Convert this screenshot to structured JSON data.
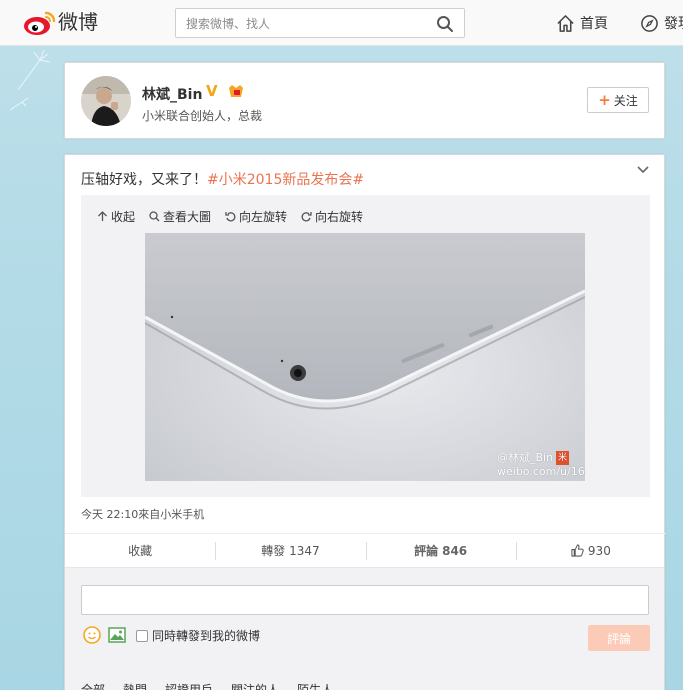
{
  "header": {
    "logo_text": "微博",
    "search_placeholder": "搜索微博、找人",
    "nav_home": "首頁",
    "nav_discover": "發現"
  },
  "profile": {
    "name": "林斌_Bin",
    "verified_mark": "V",
    "description": "小米联合创始人，总裁",
    "follow_label": "关注"
  },
  "post": {
    "text": "压轴好戏，又来了！",
    "topic": "#小米2015新品发布会#",
    "media_tools": [
      "收起",
      "查看大圖",
      "向左旋转",
      "向右旋转"
    ],
    "watermark_line1": "@林斌_Bin",
    "watermark_line2": "weibo.com/u/1686364349",
    "meta": "今天 22:10來自小米手机",
    "actions": {
      "favorite_label": "收藏",
      "repost_label": "轉發",
      "repost_count": "1347",
      "comment_label": "評論",
      "comment_count": "846",
      "like_count": "930"
    }
  },
  "comment_box": {
    "repost_checkbox_label": "同時轉發到我的微博",
    "submit_label": "評論",
    "sort_options": [
      "全部",
      "熱門",
      "認證用戶",
      "關注的人",
      "陌生人"
    ]
  },
  "colors": {
    "accent_orange": "#eb7350",
    "verified_gold": "#f2a516",
    "submit_disabled": "#fbcbb8"
  }
}
